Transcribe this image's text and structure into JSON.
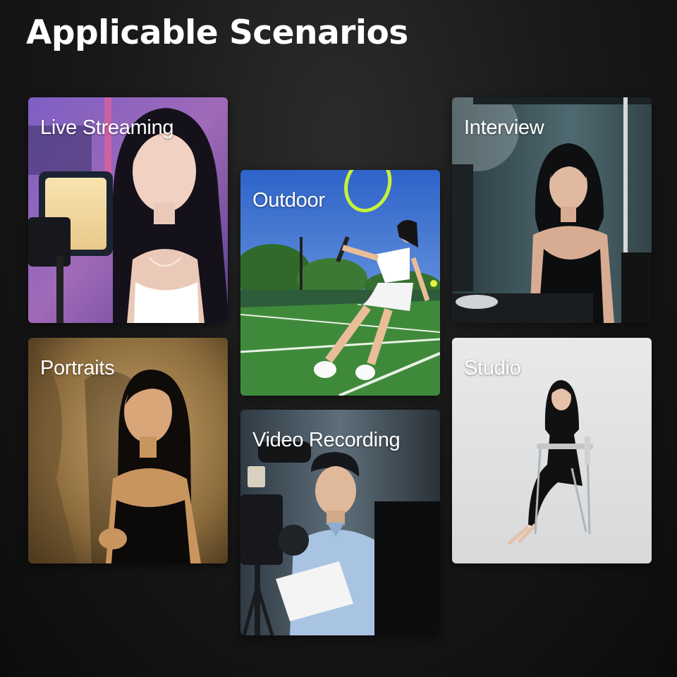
{
  "title": "Applicable Scenarios",
  "scenarios": {
    "live_streaming": "Live Streaming",
    "portraits": "Portraits",
    "outdoor": "Outdoor",
    "video_recording": "Video Recording",
    "interview": "Interview",
    "studio": "Studio"
  },
  "colors": {
    "background": "#141414",
    "text": "#ffffff"
  }
}
